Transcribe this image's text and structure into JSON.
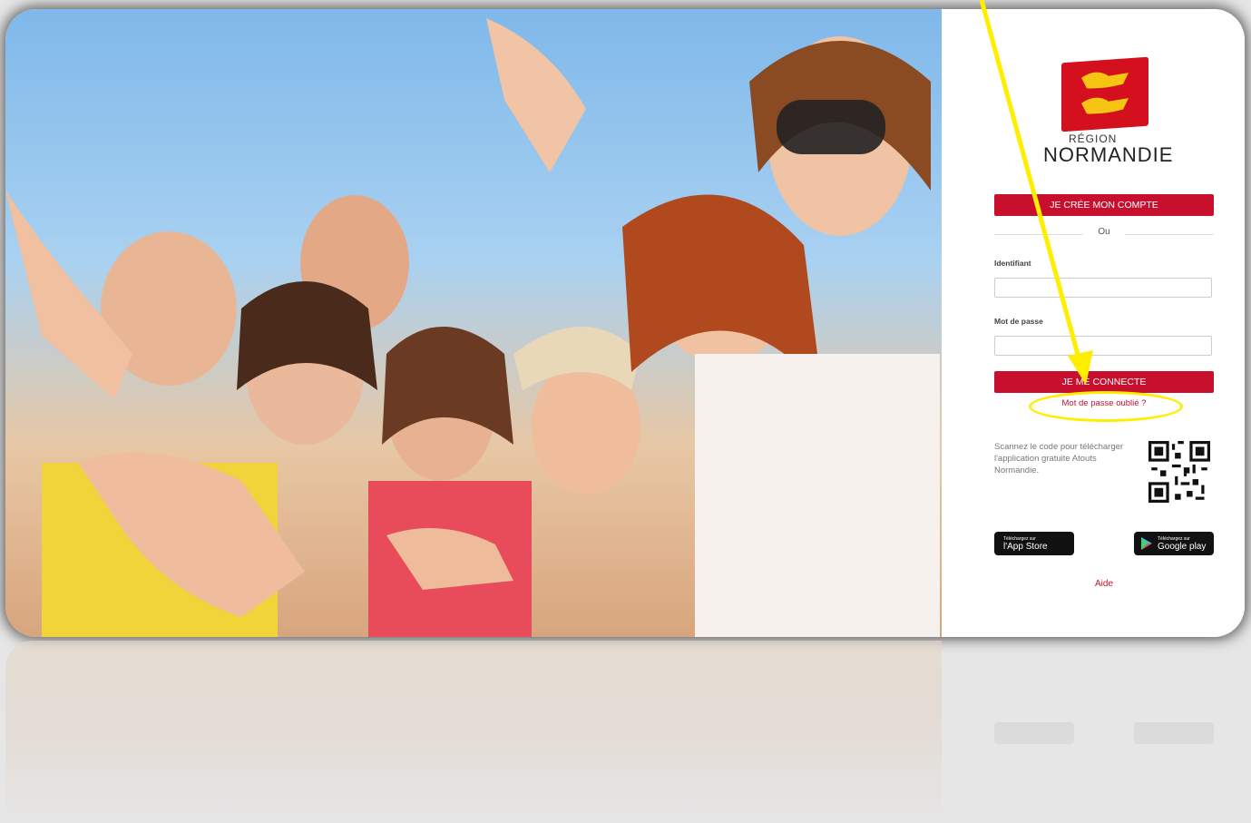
{
  "logo": {
    "region": "RÉGION",
    "name": "NORMANDIE"
  },
  "form": {
    "create_account": "JE CRÉE MON COMPTE",
    "or": "Ou",
    "username_label": "Identifiant",
    "username_value": "",
    "password_label": "Mot de passe",
    "password_value": "",
    "login": "JE ME CONNECTE",
    "forgot_password": "Mot de passe oublié ?"
  },
  "app": {
    "scan_text": "Scannez le code pour télécharger l'application gratuite Atouts Normandie.",
    "appstore_small": "Téléchargez sur",
    "appstore_big": "l'App Store",
    "googleplay_small": "Téléchargez sur",
    "googleplay_big": "Google play"
  },
  "help": "Aide",
  "colors": {
    "brand_red": "#c8102e",
    "highlight_yellow": "#ffee00"
  },
  "icons": [
    "apple-icon",
    "play-icon",
    "qr-code-icon",
    "lion-flag-icon"
  ]
}
